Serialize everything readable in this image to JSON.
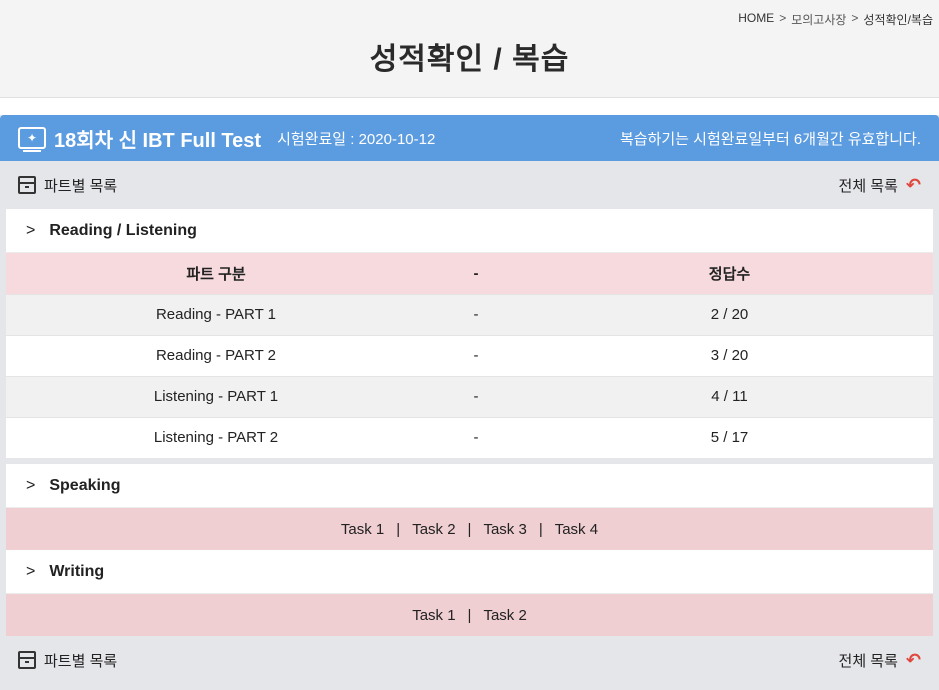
{
  "breadcrumb": {
    "home": "HOME",
    "sep1": ">",
    "mid": "모의고사장",
    "sep2": ">",
    "current": "성적확인/복습"
  },
  "page_title": "성적확인 / 복습",
  "test": {
    "icon": "test-screen-icon",
    "title": "18회차 신 IBT Full Test",
    "date": "시험완료일 : 2020-10-12",
    "review_note": "복습하기는 시험완료일부터 6개월간 유효합니다."
  },
  "list_bar": {
    "parts_label": "파트별 목록",
    "all_label": "전체 목록"
  },
  "reading_listening": {
    "title": "Reading / Listening",
    "headers": [
      "파트 구분",
      "-",
      "정답수"
    ],
    "rows": [
      [
        "Reading - PART 1",
        "-",
        "2 / 20"
      ],
      [
        "Reading - PART 2",
        "-",
        "3 / 20"
      ],
      [
        "Listening - PART 1",
        "-",
        "4 / 11"
      ],
      [
        "Listening - PART 2",
        "-",
        "5 / 17"
      ]
    ]
  },
  "speaking": {
    "title": "Speaking",
    "tasks": [
      "Task 1",
      "Task 2",
      "Task 3",
      "Task 4"
    ]
  },
  "writing": {
    "title": "Writing",
    "tasks": [
      "Task 1",
      "Task 2"
    ]
  },
  "colors": {
    "header_blue": "#5b9be0",
    "pink": "#f6dadd",
    "accent_red": "#e0463c"
  }
}
